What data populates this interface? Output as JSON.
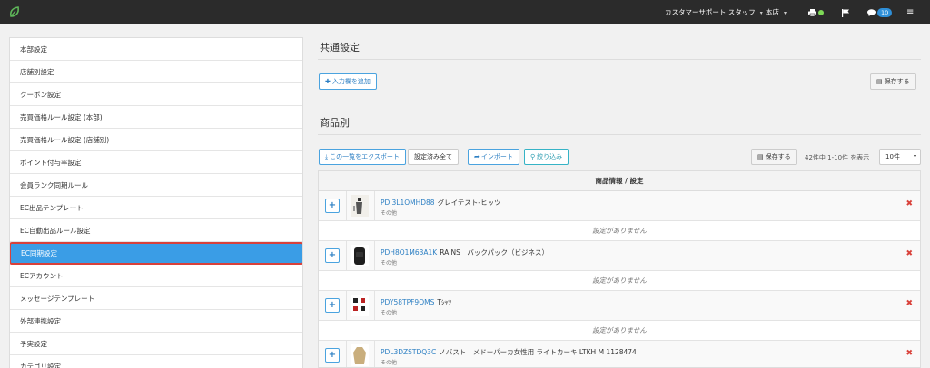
{
  "topbar": {
    "staff": "カスタマーサポート スタッフ",
    "store": "本店",
    "badge_count": "10",
    "colors": {
      "bg": "#2b2b2b",
      "logo": "#5fb85a",
      "status": "#7ed957",
      "badge": "#2e8fd8"
    }
  },
  "sidebar": {
    "items": [
      {
        "label": "本部設定"
      },
      {
        "label": "店舗別設定"
      },
      {
        "label": "クーポン設定"
      },
      {
        "label": "売買価格ルール設定 (本部)"
      },
      {
        "label": "売買価格ルール設定 (店舗別)"
      },
      {
        "label": "ポイント付与率設定"
      },
      {
        "label": "会員ランク同期ルール"
      },
      {
        "label": "EC出品テンプレート"
      },
      {
        "label": "EC自動出品ルール設定"
      },
      {
        "label": "EC同期設定",
        "active": true
      },
      {
        "label": "ECアカウント"
      },
      {
        "label": "メッセージテンプレート"
      },
      {
        "label": "外部連携設定"
      },
      {
        "label": "予実設定"
      },
      {
        "label": "カテゴリ設定"
      }
    ]
  },
  "common": {
    "title": "共通設定",
    "add_field": "入力欄を追加",
    "save": "保存する"
  },
  "products": {
    "title": "商品別",
    "export": "この一覧をエクスポート",
    "set_all": "設定済み全て",
    "import": "インポート",
    "filter": "絞り込み",
    "save": "保存する",
    "count": "42件中 1-10件 を表示",
    "per_page": "10件",
    "table_header": "商品情報 / 設定",
    "empty_text": "設定がありません",
    "rows": [
      {
        "code": "PDI3L1OMHD88",
        "name": "グレイテスト-ヒッツ",
        "category": "その他"
      },
      {
        "code": "PDH8O1M63A1K",
        "name": "RAINS　バックパック（ビジネス）",
        "category": "その他"
      },
      {
        "code": "PDY58TPF9OMS",
        "name": "Tｼｬﾂ",
        "category": "その他"
      },
      {
        "code": "PDL3DZSTDQ3C",
        "name": "ノバスト　メドーパーカ女性用 ライトカーキ LTKH M 1128474",
        "category": "その他"
      }
    ]
  }
}
